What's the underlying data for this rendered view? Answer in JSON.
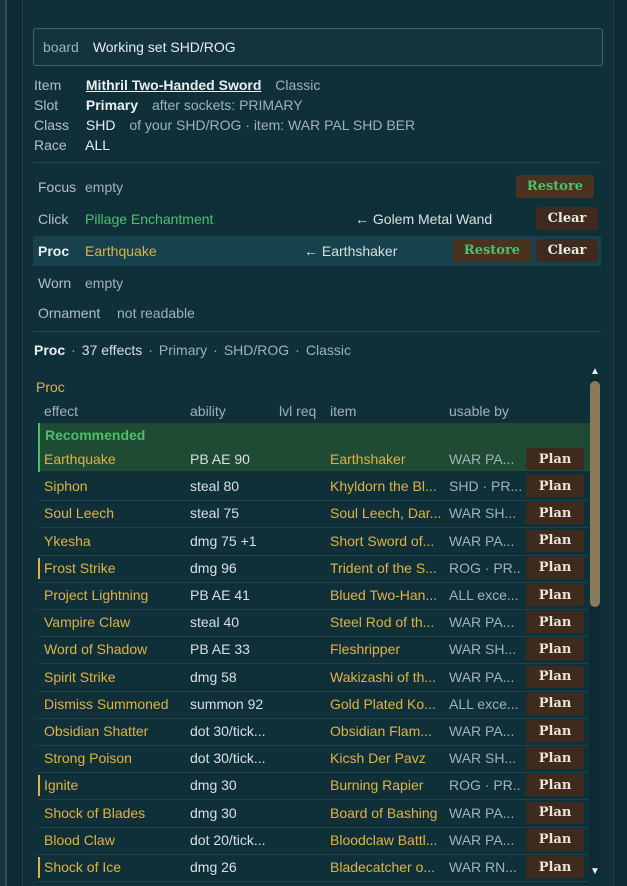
{
  "board": {
    "label": "board",
    "value": "Working set SHD/ROG"
  },
  "info": {
    "item_key": "Item",
    "item_name": "Mithril Two-Handed Sword",
    "item_tag": "Classic",
    "slot_key": "Slot",
    "slot_value": "Primary",
    "slot_meta": "after sockets: PRIMARY",
    "class_key": "Class",
    "class_value": "SHD",
    "class_meta": "of your SHD/ROG  ·  item: WAR PAL SHD BER",
    "race_key": "Race",
    "race_value": "ALL"
  },
  "slots": {
    "focus": {
      "label": "Focus",
      "value": "empty",
      "restore": "Restore"
    },
    "click": {
      "label": "Click",
      "value": "Pillage Enchantment",
      "source": "← Golem Metal Wand",
      "clear": "Clear"
    },
    "proc": {
      "label": "Proc",
      "value": "Earthquake",
      "source": "← Earthshaker",
      "restore": "Restore",
      "clear": "Clear"
    },
    "worn": {
      "label": "Worn",
      "value": "empty"
    },
    "ornament": {
      "label": "Ornament",
      "value": "not readable"
    }
  },
  "crumb": {
    "slot": "Proc",
    "count": "37 effects",
    "a": "Primary",
    "b": "SHD/ROG",
    "c": "Classic"
  },
  "section_title": "Proc",
  "columns": {
    "effect": "effect",
    "ability": "ability",
    "lvl": "lvl req",
    "item": "item",
    "usable": "usable by"
  },
  "recommended_label": "Recommended",
  "plan_label": "Plan",
  "rows": [
    {
      "effect": "Earthquake",
      "ability": "PB AE 90",
      "item": "Earthshaker",
      "usable": "WAR PA..."
    },
    {
      "effect": "Siphon",
      "ability": "steal 80",
      "item": "Khyldorn the Bl...",
      "usable": "SHD · PR..."
    },
    {
      "effect": "Soul Leech",
      "ability": "steal 75",
      "item": "Soul Leech, Dar...",
      "usable": "WAR SH..."
    },
    {
      "effect": "Ykesha",
      "ability": "dmg 75 +1",
      "item": "Short Sword of...",
      "usable": "WAR PA..."
    },
    {
      "effect": "Frost Strike",
      "ability": "dmg 96",
      "item": "Trident of the S...",
      "usable": "ROG · PR..."
    },
    {
      "effect": "Project Lightning",
      "ability": "PB AE 41",
      "item": "Blued Two-Han...",
      "usable": "ALL exce..."
    },
    {
      "effect": "Vampire Claw",
      "ability": "steal 40",
      "item": "Steel Rod of th...",
      "usable": "WAR PA..."
    },
    {
      "effect": "Word of Shadow",
      "ability": "PB AE 33",
      "item": "Fleshripper",
      "usable": "WAR SH..."
    },
    {
      "effect": "Spirit Strike",
      "ability": "dmg 58",
      "item": "Wakizashi of th...",
      "usable": "WAR PA..."
    },
    {
      "effect": "Dismiss Summoned",
      "ability": "summon 92",
      "item": "Gold Plated Ko...",
      "usable": "ALL exce..."
    },
    {
      "effect": "Obsidian Shatter",
      "ability": "dot 30/tick...",
      "item": "Obsidian Flam...",
      "usable": "WAR PA..."
    },
    {
      "effect": "Strong Poison",
      "ability": "dot 30/tick...",
      "item": "Kicsh Der Pavz",
      "usable": "WAR SH..."
    },
    {
      "effect": "Ignite",
      "ability": "dmg 30",
      "item": "Burning Rapier",
      "usable": "ROG · PR..."
    },
    {
      "effect": "Shock of Blades",
      "ability": "dmg 30",
      "item": "Board of Bashing",
      "usable": "WAR PA..."
    },
    {
      "effect": "Blood Claw",
      "ability": "dot 20/tick...",
      "item": "Bloodclaw Battl...",
      "usable": "WAR PA..."
    },
    {
      "effect": "Shock of Ice",
      "ability": "dmg 26",
      "item": "Bladecatcher o...",
      "usable": "WAR RN..."
    }
  ]
}
